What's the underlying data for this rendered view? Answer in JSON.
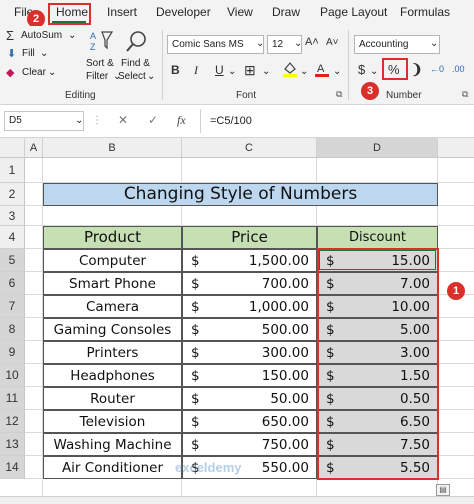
{
  "tabs": [
    "File",
    "Home",
    "Insert",
    "Developer",
    "View",
    "Draw",
    "Page Layout",
    "Formulas"
  ],
  "ribbon": {
    "autosum": "AutoSum",
    "fill": "Fill",
    "clear": "Clear",
    "sort_filter": [
      "Sort &",
      "Filter"
    ],
    "find_select": [
      "Find &",
      "Select"
    ],
    "editing_label": "Editing",
    "font_name": "Comic Sans MS",
    "font_size": "12",
    "font_label": "Font",
    "bold": "B",
    "italic": "I",
    "underline": "U",
    "number_format": "Accounting",
    "number_label": "Number",
    "currency": "$",
    "percent": "%",
    "comma": "❩"
  },
  "markers": [
    "1",
    "2",
    "3"
  ],
  "formula_bar": {
    "name_box": "D5",
    "fx": "fx",
    "formula": "=C5/100"
  },
  "columns": [
    "A",
    "B",
    "C",
    "D"
  ],
  "rows": [
    "1",
    "2",
    "3",
    "4",
    "5",
    "6",
    "7",
    "8",
    "9",
    "10",
    "11",
    "12",
    "13",
    "14"
  ],
  "sheet": {
    "title": "Changing Style of Numbers",
    "headers": {
      "product": "Product",
      "price": "Price",
      "discount": "Discount"
    },
    "data": [
      {
        "product": "Computer",
        "price": "1,500.00",
        "discount": "15.00"
      },
      {
        "product": "Smart Phone",
        "price": "700.00",
        "discount": "7.00"
      },
      {
        "product": "Camera",
        "price": "1,000.00",
        "discount": "10.00"
      },
      {
        "product": "Gaming Consoles",
        "price": "500.00",
        "discount": "5.00"
      },
      {
        "product": "Printers",
        "price": "300.00",
        "discount": "3.00"
      },
      {
        "product": "Headphones",
        "price": "150.00",
        "discount": "1.50"
      },
      {
        "product": "Router",
        "price": "50.00",
        "discount": "0.50"
      },
      {
        "product": "Television",
        "price": "650.00",
        "discount": "6.50"
      },
      {
        "product": "Washing Machine",
        "price": "750.00",
        "discount": "7.50"
      },
      {
        "product": "Air Conditioner",
        "price": "550.00",
        "discount": "5.50"
      }
    ],
    "currency_symbol": "$"
  },
  "watermark": "exceldemy",
  "colors": {
    "accent_red": "#d9302c",
    "title_fill": "#bdd7ee",
    "header_fill": "#c6e0b4",
    "selection_fill": "#d9d9d9",
    "excel_green": "#1e7145"
  }
}
